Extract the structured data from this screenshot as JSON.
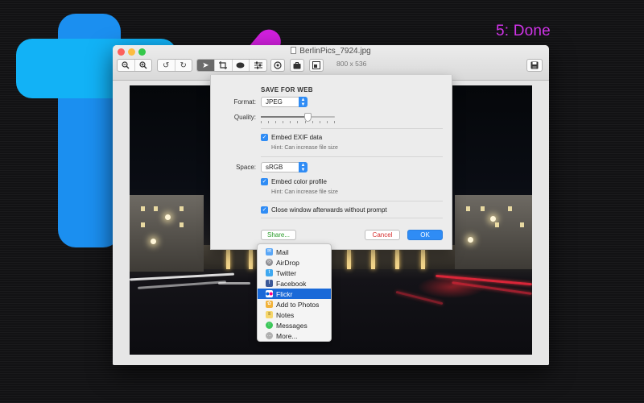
{
  "step_label": "5: Done",
  "colors": {
    "accent": "#2f8cf5",
    "step_label": "#d435ec",
    "selected_menu": "#1969d8"
  },
  "window": {
    "title": "BerlinPics_7924.jpg",
    "dimensions": "800 x 536",
    "toolbar_icons": [
      "zoom-out-icon",
      "zoom-in-icon",
      "rotate-left-icon",
      "rotate-right-icon",
      "pointer-icon",
      "crop-icon",
      "ellipse-icon",
      "adjust-icon",
      "effects-icon",
      "briefcase-icon",
      "resize-icon",
      "save-icon"
    ]
  },
  "save_sheet": {
    "heading": "SAVE FOR WEB",
    "format_label": "Format:",
    "format_value": "JPEG",
    "quality_label": "Quality:",
    "quality_level": 0.65,
    "embed_exif_label": "Embed EXIF data",
    "embed_exif_hint": "Hint: Can increase file size",
    "space_label": "Space:",
    "space_value": "sRGB",
    "embed_color_label": "Embed color profile",
    "embed_color_hint": "Hint: Can increase file size",
    "close_window_label": "Close window afterwards without prompt",
    "share_button": "Share...",
    "cancel_button": "Cancel",
    "ok_button": "OK"
  },
  "share_menu": {
    "items": [
      {
        "label": "Mail",
        "icon": "mail-icon"
      },
      {
        "label": "AirDrop",
        "icon": "airdrop-icon"
      },
      {
        "label": "Twitter",
        "icon": "twitter-icon"
      },
      {
        "label": "Facebook",
        "icon": "facebook-icon"
      },
      {
        "label": "Flickr",
        "icon": "flickr-icon",
        "selected": true
      },
      {
        "label": "Add to Photos",
        "icon": "photos-icon"
      },
      {
        "label": "Notes",
        "icon": "notes-icon"
      },
      {
        "label": "Messages",
        "icon": "messages-icon"
      },
      {
        "label": "More...",
        "icon": "more-icon"
      }
    ]
  }
}
